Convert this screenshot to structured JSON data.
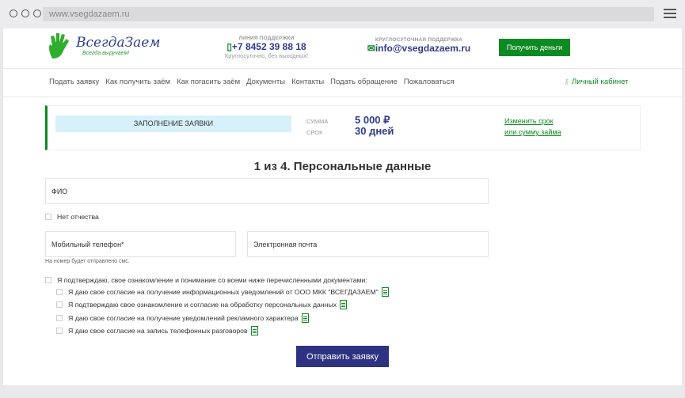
{
  "browser": {
    "url": "www.vsegdazaem.ru"
  },
  "header": {
    "logo_text": "ВсегдаЗаем",
    "logo_sub": "Всегда выручаем!",
    "support_line": {
      "label": "ЛИНИЯ ПОДДЕРЖКИ",
      "phone": "+7 8452 39 88 18",
      "note": "Круглосуточно, без выходных!"
    },
    "support_24": {
      "label": "КРУГЛОСУТОЧНАЯ ПОДДЕРЖКА",
      "email": "info@vsegdazaem.ru"
    },
    "get_money_label": "Получить деньги"
  },
  "nav": {
    "items": [
      "Подать заявку",
      "Как получить заём",
      "Как погасить заём",
      "Документы",
      "Контакты",
      "Подать обращение",
      "Пожаловаться"
    ],
    "cabinet": "Личный кабинет"
  },
  "status": {
    "step_label": "ЗАПОЛНЕНИЕ ЗАЯВКИ",
    "sum_label": "СУММА",
    "sum_value": "5 000 ₽",
    "term_label": "СРОК",
    "term_value": "30 дней",
    "change_line1": "Изменить срок",
    "change_line2": "или сумму займа"
  },
  "form": {
    "title": "1 из 4. Персональные данные",
    "fio": "ФИО",
    "no_patronymic": "Нет отчества",
    "phone": "Мобильный телефон*",
    "email": "Электронная почта",
    "sms_note": "На номер будет отправлено смс.",
    "consent_main": "Я подтверждаю, свое ознакомление и понимание со всеми ниже перечисленными документами:",
    "consents": [
      "Я даю свое согласие на получение информационных уведомлений от ООО МКК \"ВСЕГДАЗАЕМ\"",
      "Я подтверждаю свое ознакомление и согласие на обработку персональных данных",
      "Я даю свое согласие на получение уведомлений рекламного характера",
      "Я даю свое согласие на запись телефонных разговоров"
    ],
    "submit": "Отправить заявку"
  },
  "colors": {
    "brand_green": "#0e8a23",
    "brand_blue": "#2f3b8f",
    "submit_bg": "#2d3380"
  }
}
